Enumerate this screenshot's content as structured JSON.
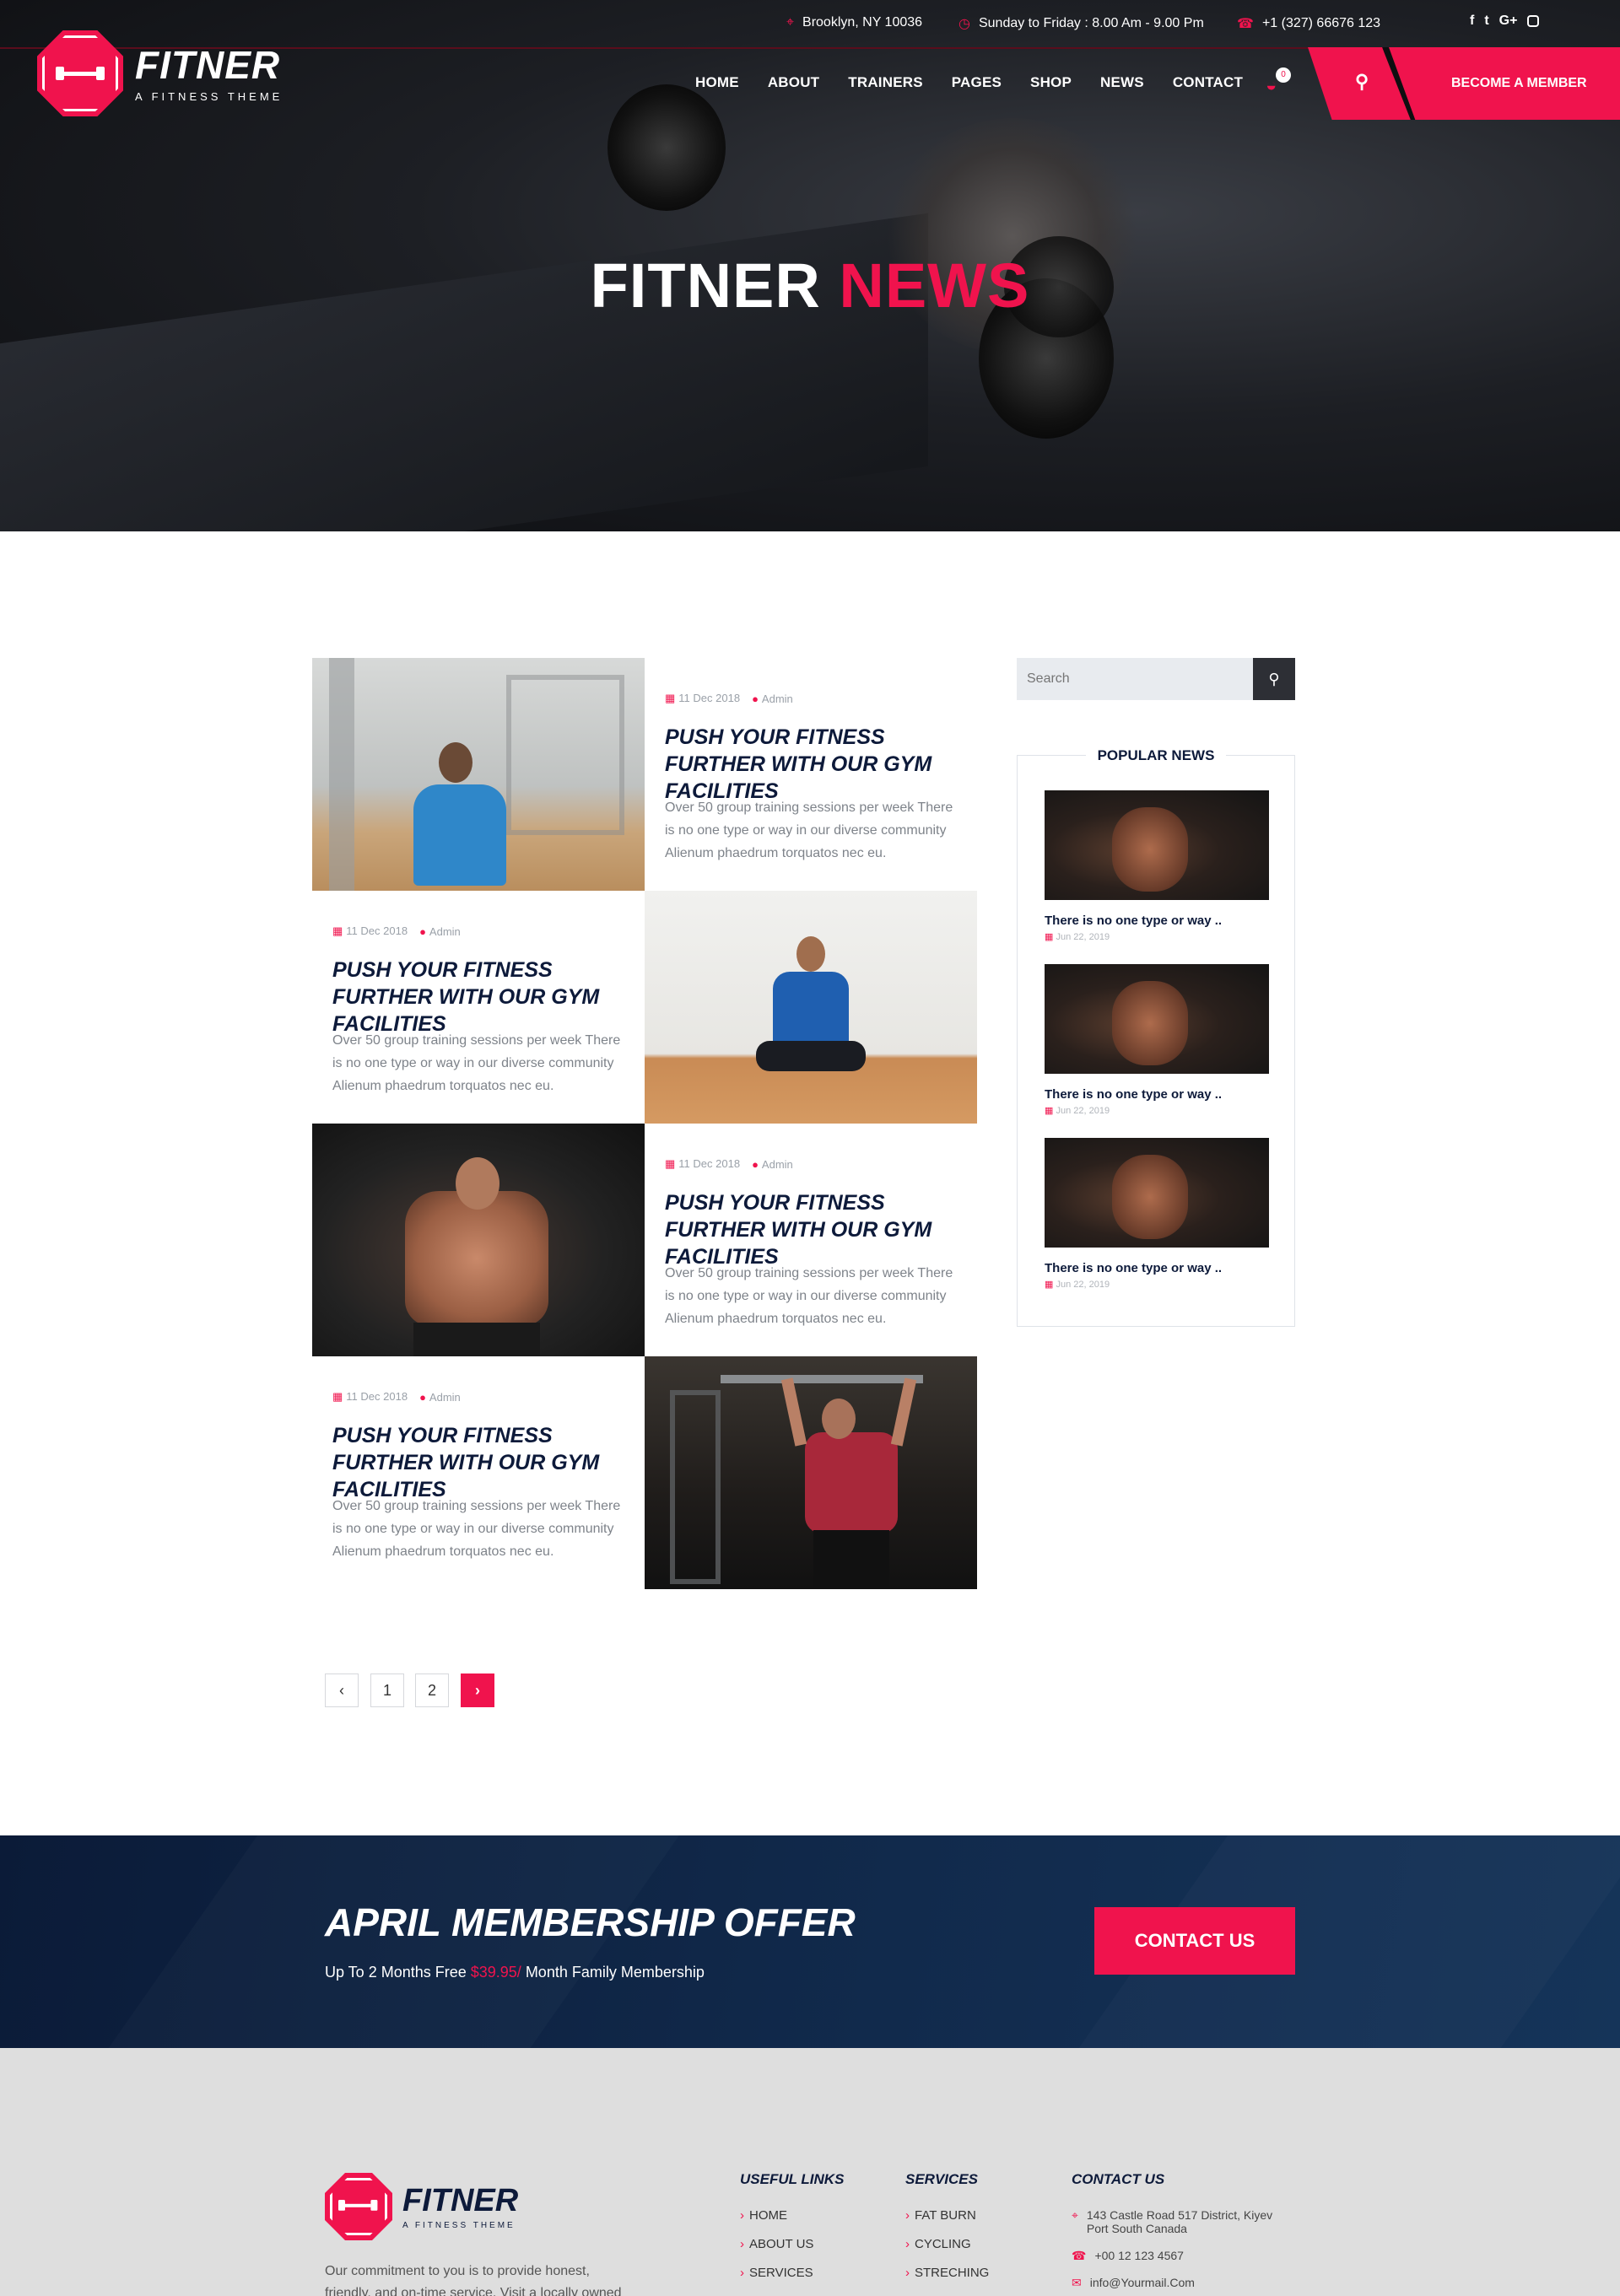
{
  "topbar": {
    "address": "Brooklyn, NY 10036",
    "hours": "Sunday to Friday : 8.00 Am - 9.00 Pm",
    "phone": "+1 (327) 66676 123",
    "social": [
      "f",
      "t",
      "G+",
      "ig"
    ]
  },
  "logo": {
    "name": "FITNER",
    "tagline": "A FITNESS THEME"
  },
  "nav": [
    "HOME",
    "ABOUT",
    "TRAINERS",
    "PAGES",
    "SHOP",
    "NEWS",
    "CONTACT"
  ],
  "cart": {
    "count": "0"
  },
  "become_member": "BECOME A MEMBER",
  "hero": {
    "title_white": "FITNER",
    "title_red": "NEWS"
  },
  "posts": [
    {
      "date": "11 Dec 2018",
      "author": "Admin",
      "title": "PUSH YOUR FITNESS FURTHER WITH OUR GYM FACILITIES",
      "body": "Over 50 group training sessions per week There is no one type or way in our diverse community Alienum phaedrum torquatos nec eu."
    },
    {
      "date": "11 Dec 2018",
      "author": "Admin",
      "title": "PUSH YOUR FITNESS FURTHER WITH OUR GYM FACILITIES",
      "body": "Over 50 group training sessions per week There is no one type or way in our diverse community Alienum phaedrum torquatos nec eu."
    },
    {
      "date": "11 Dec 2018",
      "author": "Admin",
      "title": "PUSH YOUR FITNESS FURTHER WITH OUR GYM FACILITIES",
      "body": "Over 50 group training sessions per week There is no one type or way in our diverse community Alienum phaedrum torquatos nec eu."
    },
    {
      "date": "11 Dec 2018",
      "author": "Admin",
      "title": "PUSH YOUR FITNESS FURTHER WITH OUR GYM FACILITIES",
      "body": "Over 50 group training sessions per week There is no one type or way in our diverse community Alienum phaedrum torquatos nec eu."
    }
  ],
  "pagination": {
    "prev": "‹",
    "pages": [
      "1",
      "2"
    ],
    "next": "›"
  },
  "sidebar": {
    "search_placeholder": "Search",
    "popular_title": "POPULAR NEWS",
    "popular": [
      {
        "title": "There is no one type or way ..",
        "date": "Jun 22, 2019"
      },
      {
        "title": "There is no one type or way ..",
        "date": "Jun 22, 2019"
      },
      {
        "title": "There is no one type or way ..",
        "date": "Jun 22, 2019"
      }
    ]
  },
  "cta": {
    "title": "APRIL MEMBERSHIP OFFER",
    "sub_before": "Up To 2 Months Free ",
    "price": "$39.95/",
    "sub_after": " Month Family Membership",
    "button": "CONTACT US"
  },
  "footer": {
    "name": "FITNER",
    "tagline": "A FITNESS THEME",
    "desc": "Our commitment to you is to provide honest, friendly, and on-time service. Visit a locally owned",
    "useful_title": "USEFUL LINKS",
    "useful": [
      "HOME",
      "ABOUT US",
      "SERVICES"
    ],
    "services_title": "SERVICES",
    "services": [
      "FAT BURN",
      "CYCLING",
      "STRECHING"
    ],
    "contact_title": "CONTACT US",
    "address": "143 Castle Road 517 District, Kiyev Port South Canada",
    "phone": "+00 12 123 4567",
    "email": "info@Yourmail.Com"
  },
  "colors": {
    "accent": "#f0134d",
    "navy": "#0d1a3a",
    "cta_bg": "#0b1b38",
    "footer_bg": "#dedede"
  }
}
